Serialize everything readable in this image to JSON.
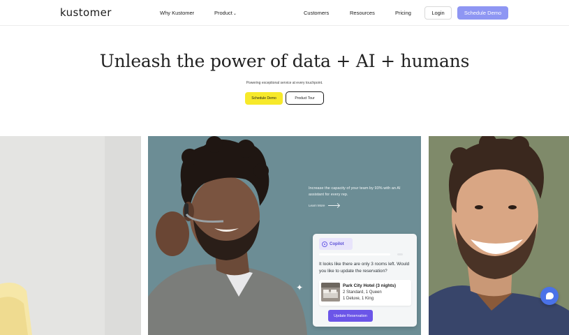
{
  "nav": {
    "logo": "kustomer",
    "links": [
      "Why Kustomer",
      "Product",
      "Customers",
      "Resources",
      "Pricing"
    ],
    "product_chevron": "chevron-down-icon",
    "login": "Login",
    "schedule_demo": "Schedule Demo"
  },
  "hero": {
    "title": "Unleash the power of data + AI + humans",
    "subtitle": "Powering exceptional service at every touchpoint.",
    "cta_primary": "Schedule Demo",
    "cta_secondary": "Product Tour"
  },
  "slide": {
    "promo": "Increase the capacity of your team by 93% with an AI assistant for every rep.",
    "learn_more": "Learn More",
    "copilot": {
      "label": "Copilot",
      "message": "It looks like there are only 3 rooms left. Would you like to update the reservation?",
      "hotel_name": "Park City Hotel (3 nights)",
      "hotel_line1": "2 Standard, 1 Queen",
      "hotel_line2": "1 Deluxe, 1 King",
      "update_button": "Update Reservation"
    }
  },
  "colors": {
    "accent": "#8e96f3",
    "cta_yellow": "#f7e92a",
    "panel_teal": "#6c8d95",
    "button_purple": "#6b55e8",
    "chat_blue": "#4a72e8"
  }
}
